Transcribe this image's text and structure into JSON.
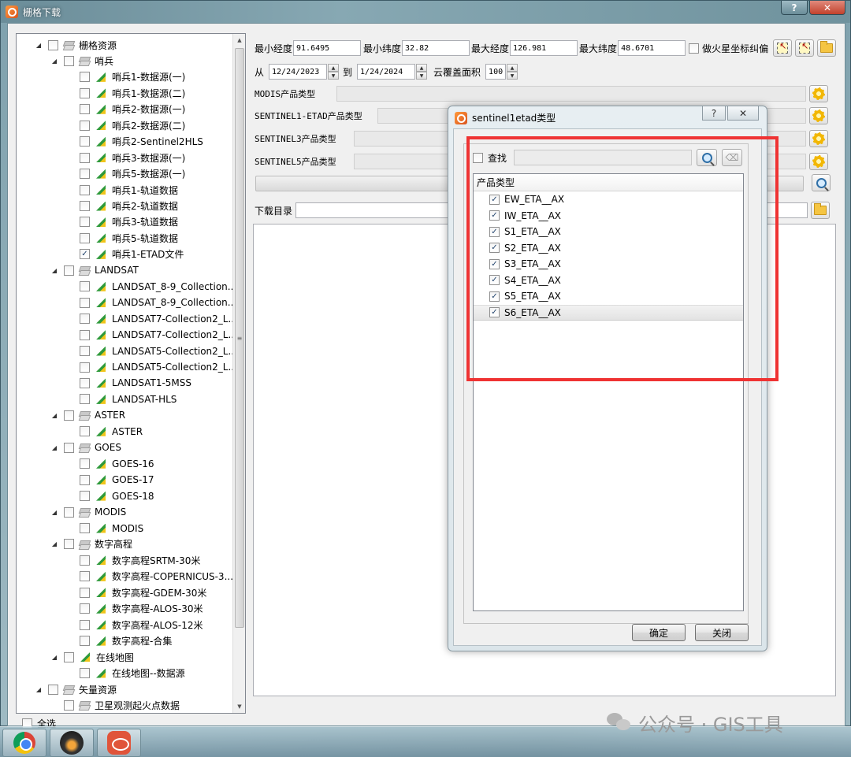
{
  "window": {
    "title": "栅格下载",
    "help": "?",
    "close": "✕"
  },
  "tree": {
    "rows": [
      {
        "level": 0,
        "expander": "◢",
        "checked": false,
        "icon": "layers-icon",
        "label": "栅格资源"
      },
      {
        "level": 1,
        "expander": "◢",
        "checked": false,
        "icon": "layers-icon",
        "label": "哨兵"
      },
      {
        "level": 2,
        "expander": "",
        "checked": false,
        "icon": "raster-icon",
        "label": "哨兵1-数据源(一)"
      },
      {
        "level": 2,
        "expander": "",
        "checked": false,
        "icon": "raster-icon",
        "label": "哨兵1-数据源(二)"
      },
      {
        "level": 2,
        "expander": "",
        "checked": false,
        "icon": "raster-icon",
        "label": "哨兵2-数据源(一)"
      },
      {
        "level": 2,
        "expander": "",
        "checked": false,
        "icon": "raster-icon",
        "label": "哨兵2-数据源(二)"
      },
      {
        "level": 2,
        "expander": "",
        "checked": false,
        "icon": "raster-icon",
        "label": "哨兵2-Sentinel2HLS"
      },
      {
        "level": 2,
        "expander": "",
        "checked": false,
        "icon": "raster-icon",
        "label": "哨兵3-数据源(一)"
      },
      {
        "level": 2,
        "expander": "",
        "checked": false,
        "icon": "raster-icon",
        "label": "哨兵5-数据源(一)"
      },
      {
        "level": 2,
        "expander": "",
        "checked": false,
        "icon": "raster-icon",
        "label": "哨兵1-轨道数据"
      },
      {
        "level": 2,
        "expander": "",
        "checked": false,
        "icon": "raster-icon",
        "label": "哨兵2-轨道数据"
      },
      {
        "level": 2,
        "expander": "",
        "checked": false,
        "icon": "raster-icon",
        "label": "哨兵3-轨道数据"
      },
      {
        "level": 2,
        "expander": "",
        "checked": false,
        "icon": "raster-icon",
        "label": "哨兵5-轨道数据"
      },
      {
        "level": 2,
        "expander": "",
        "checked": true,
        "icon": "raster-icon",
        "label": "哨兵1-ETAD文件"
      },
      {
        "level": 1,
        "expander": "◢",
        "checked": false,
        "icon": "layers-icon",
        "label": "LANDSAT"
      },
      {
        "level": 2,
        "expander": "",
        "checked": false,
        "icon": "raster-icon",
        "label": "LANDSAT_8-9_Collection..."
      },
      {
        "level": 2,
        "expander": "",
        "checked": false,
        "icon": "raster-icon",
        "label": "LANDSAT_8-9_Collection..."
      },
      {
        "level": 2,
        "expander": "",
        "checked": false,
        "icon": "raster-icon",
        "label": "LANDSAT7-Collection2_L..."
      },
      {
        "level": 2,
        "expander": "",
        "checked": false,
        "icon": "raster-icon",
        "label": "LANDSAT7-Collection2_L..."
      },
      {
        "level": 2,
        "expander": "",
        "checked": false,
        "icon": "raster-icon",
        "label": "LANDSAT5-Collection2_L..."
      },
      {
        "level": 2,
        "expander": "",
        "checked": false,
        "icon": "raster-icon",
        "label": "LANDSAT5-Collection2_L..."
      },
      {
        "level": 2,
        "expander": "",
        "checked": false,
        "icon": "raster-icon",
        "label": "LANDSAT1-5MSS"
      },
      {
        "level": 2,
        "expander": "",
        "checked": false,
        "icon": "raster-icon",
        "label": "LANDSAT-HLS"
      },
      {
        "level": 1,
        "expander": "◢",
        "checked": false,
        "icon": "layers-icon",
        "label": "ASTER"
      },
      {
        "level": 2,
        "expander": "",
        "checked": false,
        "icon": "raster-icon",
        "label": "ASTER"
      },
      {
        "level": 1,
        "expander": "◢",
        "checked": false,
        "icon": "layers-icon",
        "label": "GOES"
      },
      {
        "level": 2,
        "expander": "",
        "checked": false,
        "icon": "raster-icon",
        "label": "GOES-16"
      },
      {
        "level": 2,
        "expander": "",
        "checked": false,
        "icon": "raster-icon",
        "label": "GOES-17"
      },
      {
        "level": 2,
        "expander": "",
        "checked": false,
        "icon": "raster-icon",
        "label": "GOES-18"
      },
      {
        "level": 1,
        "expander": "◢",
        "checked": false,
        "icon": "layers-icon",
        "label": "MODIS"
      },
      {
        "level": 2,
        "expander": "",
        "checked": false,
        "icon": "raster-icon",
        "label": "MODIS"
      },
      {
        "level": 1,
        "expander": "◢",
        "checked": false,
        "icon": "layers-icon",
        "label": "数字高程"
      },
      {
        "level": 2,
        "expander": "",
        "checked": false,
        "icon": "raster-icon",
        "label": "数字高程SRTM-30米"
      },
      {
        "level": 2,
        "expander": "",
        "checked": false,
        "icon": "raster-icon",
        "label": "数字高程-COPERNICUS-3..."
      },
      {
        "level": 2,
        "expander": "",
        "checked": false,
        "icon": "raster-icon",
        "label": "数字高程-GDEM-30米"
      },
      {
        "level": 2,
        "expander": "",
        "checked": false,
        "icon": "raster-icon",
        "label": "数字高程-ALOS-30米"
      },
      {
        "level": 2,
        "expander": "",
        "checked": false,
        "icon": "raster-icon",
        "label": "数字高程-ALOS-12米"
      },
      {
        "level": 2,
        "expander": "",
        "checked": false,
        "icon": "raster-icon",
        "label": "数字高程-合集"
      },
      {
        "level": 1,
        "expander": "◢",
        "checked": false,
        "icon": "raster-icon",
        "label": "在线地图"
      },
      {
        "level": 2,
        "expander": "",
        "checked": false,
        "icon": "raster-icon",
        "label": "在线地图--数据源"
      },
      {
        "level": 0,
        "expander": "◢",
        "checked": false,
        "icon": "layers-icon",
        "label": "矢量资源"
      },
      {
        "level": 1,
        "expander": "",
        "checked": false,
        "icon": "layers-icon",
        "label": "卫星观测起火点数据"
      }
    ],
    "select_all": "全选"
  },
  "filters": {
    "min_lon_label": "最小经度",
    "min_lon": "91.6495",
    "min_lat_label": "最小纬度",
    "min_lat": "32.82",
    "max_lon_label": "最大经度",
    "max_lon": "126.981",
    "max_lat_label": "最大纬度",
    "max_lat": "48.6701",
    "mars_label": "做火星坐标纠偏",
    "from_label": "从",
    "from_date": "12/24/2023",
    "to_label": "到",
    "to_date": "1/24/2024",
    "cloud_label": "云覆盖面积",
    "cloud_value": "100",
    "modis_label": "MODIS产品类型",
    "s1_label": "SENTINEL1-ETAD产品类型",
    "s3_label": "SENTINEL3产品类型",
    "s5_label": "SENTINEL5产品类型",
    "dir_label": "下载目录"
  },
  "dialog": {
    "title": "sentinel1etad类型",
    "help": "?",
    "close": "✕",
    "find_label": "查找",
    "list_header": "产品类型",
    "items": [
      {
        "label": "EW_ETA__AX",
        "checked": true
      },
      {
        "label": "IW_ETA__AX",
        "checked": true
      },
      {
        "label": "S1_ETA__AX",
        "checked": true
      },
      {
        "label": "S2_ETA__AX",
        "checked": true
      },
      {
        "label": "S3_ETA__AX",
        "checked": true
      },
      {
        "label": "S4_ETA__AX",
        "checked": true
      },
      {
        "label": "S5_ETA__AX",
        "checked": true
      },
      {
        "label": "S6_ETA__AX",
        "checked": true
      }
    ],
    "ok": "确定",
    "cancel": "关闭"
  },
  "watermark": "公众号 · GIS工具",
  "colors": {
    "highlight": "#ef3333"
  }
}
